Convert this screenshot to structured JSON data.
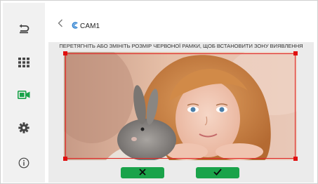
{
  "window": {
    "title": "CAM1"
  },
  "sidebar": {
    "items": [
      {
        "name": "back-return",
        "icon": "return-arrow-icon",
        "active": false
      },
      {
        "name": "grid",
        "icon": "grid-icon",
        "active": false
      },
      {
        "name": "camera",
        "icon": "video-camera-icon",
        "active": true
      },
      {
        "name": "settings",
        "icon": "gear-icon",
        "active": false
      },
      {
        "name": "info",
        "icon": "info-icon",
        "active": false
      }
    ]
  },
  "header": {
    "back_icon": "chevron-left-icon",
    "camera_icon": "camera-logo-icon",
    "title": "CAM1"
  },
  "instruction": "ПЕРЕТЯГНІТЬ АБО ЗМІНІТЬ РОЗМІР ЧЕРВОНОЇ РАМКИ, ЩОБ ВСТАНОВИТИ ЗОНУ ВИЯВЛЕННЯ",
  "actions": {
    "cancel_icon": "close-icon",
    "confirm_icon": "check-icon"
  },
  "colors": {
    "accent_green": "#1aa34a",
    "roi_red": "#e02020",
    "sidebar_bg": "#f1f1f1",
    "content_bg": "#ebebeb"
  }
}
